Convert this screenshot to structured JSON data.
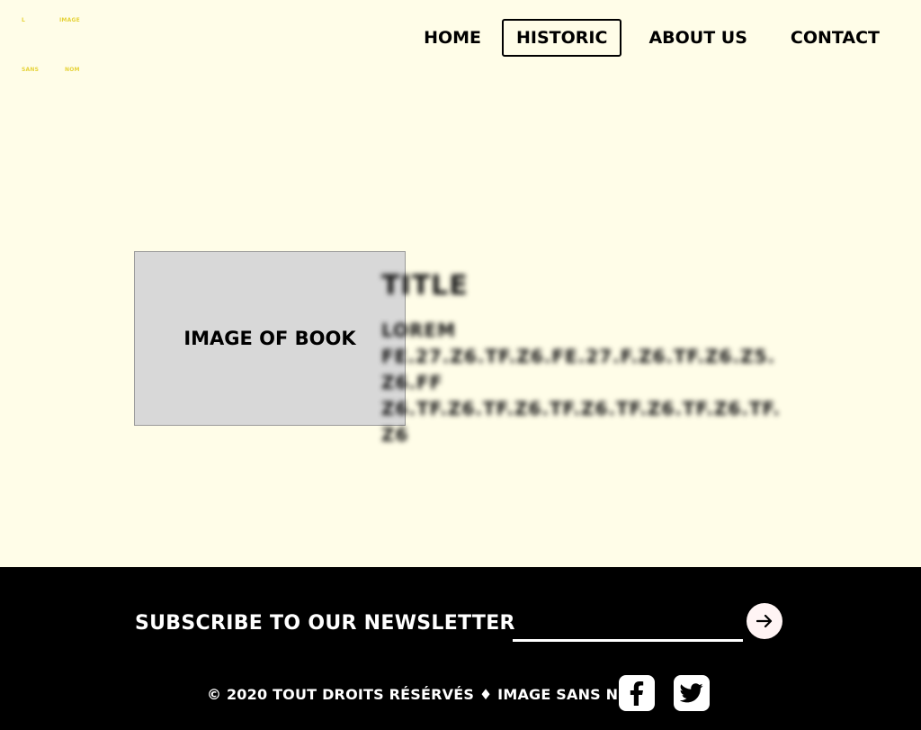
{
  "logo": {
    "w1": "L",
    "w2": "IMAGE",
    "w3": "SANS",
    "w4": "NOM"
  },
  "nav": {
    "items": [
      {
        "label": "HOME"
      },
      {
        "label": "HISTORIC",
        "active": true
      },
      {
        "label": "ABOUT US"
      },
      {
        "label": "CONTACT"
      }
    ]
  },
  "main": {
    "image_placeholder": "IMAGE OF BOOK",
    "title": "TITLE",
    "body_line1": "LOREM",
    "body_line2": "FE.27.Z6.TF.Z6.FE.27.F.Z6.TF.Z6.Z5.Z6.FF",
    "body_line3": "Z6.TF.Z6.TF.Z6.TF.Z6.TF.Z6.TF.Z6.TF.Z6"
  },
  "footer": {
    "newsletter_label": "SUBSCRIBE TO OUR NEWSLETTER",
    "newsletter_value": "",
    "copyright": "© 2020 TOUT DROITS RÉSÉRVÉS ♦ IMAGE SANS NOM",
    "submit_icon": "arrow-right-icon",
    "social": [
      "facebook-icon",
      "twitter-icon"
    ]
  },
  "colors": {
    "background": "#fffde8",
    "footer": "#000000",
    "logo": "#e6d33a",
    "image_placeholder": "#d8d8d8"
  }
}
